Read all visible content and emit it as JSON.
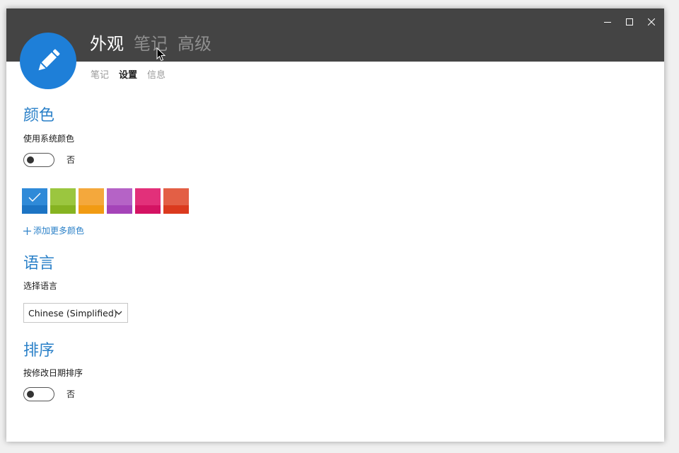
{
  "window": {
    "controls": [
      {
        "name": "minimize",
        "icon": "minimize-icon"
      },
      {
        "name": "maximize",
        "icon": "maximize-icon"
      },
      {
        "name": "close",
        "icon": "close-icon"
      }
    ]
  },
  "app": {
    "logo_icon": "pencil-icon",
    "logo_color": "#1e7fd8"
  },
  "main_tabs": [
    {
      "label": "外观",
      "active": true
    },
    {
      "label": "笔记",
      "active": false
    },
    {
      "label": "高级",
      "active": false
    }
  ],
  "sub_tabs": [
    {
      "label": "笔记",
      "active": false
    },
    {
      "label": "设置",
      "active": true
    },
    {
      "label": "信息",
      "active": false
    }
  ],
  "color_section": {
    "title": "颜色",
    "use_system_label": "使用系统颜色",
    "toggle_state": "否",
    "swatches": [
      {
        "top": "#2f8ad8",
        "bottom": "#1c74c4",
        "selected": true
      },
      {
        "top": "#9bc63f",
        "bottom": "#86b321",
        "selected": false
      },
      {
        "top": "#f4a83c",
        "bottom": "#f19b13",
        "selected": false
      },
      {
        "top": "#b563c6",
        "bottom": "#a544b8",
        "selected": false
      },
      {
        "top": "#e2307a",
        "bottom": "#d41363",
        "selected": false
      },
      {
        "top": "#e35f45",
        "bottom": "#db3a1e",
        "selected": false
      }
    ],
    "add_more_label": "添加更多颜色"
  },
  "language_section": {
    "title": "语言",
    "select_label": "选择语言",
    "selected_value": "Chinese (Simplified)"
  },
  "sort_section": {
    "title": "排序",
    "sort_label": "按修改日期排序",
    "toggle_state": "否"
  }
}
